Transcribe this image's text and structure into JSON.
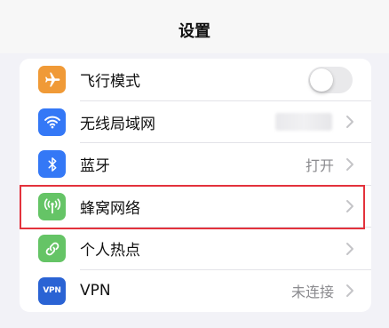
{
  "nav": {
    "title": "设置"
  },
  "settings": {
    "rows": [
      {
        "label": "飞行模式",
        "icon": "airplane-icon",
        "icon_color": "#f09a37",
        "control": "toggle",
        "toggle_on": false
      },
      {
        "label": "无线局域网",
        "icon": "wifi-icon",
        "icon_color": "#3478f6",
        "control": "chevron",
        "value_blurred": true
      },
      {
        "label": "蓝牙",
        "icon": "bluetooth-icon",
        "icon_color": "#3478f6",
        "control": "chevron",
        "value": "打开"
      },
      {
        "label": "蜂窝网络",
        "icon": "cellular-antenna-icon",
        "icon_color": "#65c466",
        "control": "chevron",
        "highlighted": true
      },
      {
        "label": "个人热点",
        "icon": "hotspot-link-icon",
        "icon_color": "#65c466",
        "control": "chevron"
      },
      {
        "label": "VPN",
        "icon": "vpn-icon",
        "icon_text": "VPN",
        "icon_color": "#2a63d4",
        "control": "chevron",
        "value": "未连接"
      }
    ]
  },
  "colors": {
    "background": "#f2f2f7",
    "highlight_border": "#e3323c",
    "secondary_text": "#8a8a8e"
  }
}
